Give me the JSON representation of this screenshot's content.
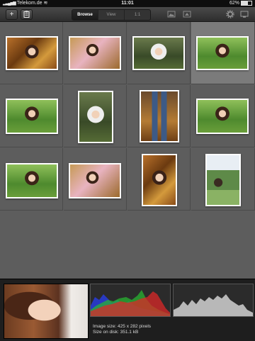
{
  "status_bar": {
    "carrier": "Telekom.de",
    "time": "11:01",
    "battery": "62%"
  },
  "toolbar": {
    "add_label": "+",
    "tabs": [
      {
        "label": "Browse",
        "active": true
      },
      {
        "label": "View",
        "active": false
      },
      {
        "label": "1:1",
        "active": false
      }
    ],
    "icons": [
      "add-icon",
      "clipboard-icon",
      "image-frame-icon",
      "image-export-icon",
      "gear-icon",
      "monitor-icon"
    ]
  },
  "grid": {
    "thumbnails": [
      {
        "style": "autumn",
        "selected": false
      },
      {
        "style": "pink",
        "selected": false
      },
      {
        "style": "hood",
        "selected": false
      },
      {
        "style": "green",
        "selected": true
      },
      {
        "style": "green",
        "selected": false
      },
      {
        "style": "hood",
        "selected": false
      },
      {
        "style": "legs",
        "selected": false
      },
      {
        "style": "green",
        "selected": false
      },
      {
        "style": "green",
        "selected": false
      },
      {
        "style": "pink",
        "selected": false
      },
      {
        "style": "autumn",
        "selected": false
      },
      {
        "style": "tree",
        "selected": false
      }
    ]
  },
  "info": {
    "image_size": "Image size: 425 x 282 pixels",
    "disk_size": "Size on disk: 351.1 kB"
  },
  "colors": {
    "background": "#5d5d5d",
    "selected_cell": "#7b7b7b",
    "panel": "#1e1e1e"
  }
}
